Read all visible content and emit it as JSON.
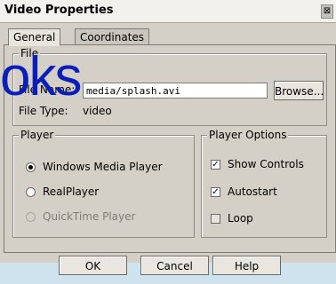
{
  "window": {
    "title": "Video Properties",
    "close_glyph": "⊠"
  },
  "tabs": [
    {
      "label": "General",
      "active": true
    },
    {
      "label": "Coordinates",
      "active": false
    }
  ],
  "file_group": {
    "legend": "File",
    "name_label": "File Name:",
    "name_value": "media/splash.avi",
    "browse_label": "Browse...",
    "type_label": "File Type:",
    "type_value": "video"
  },
  "player_group": {
    "legend": "Player",
    "options": [
      {
        "label": "Windows Media Player",
        "selected": true,
        "disabled": false
      },
      {
        "label": "RealPlayer",
        "selected": false,
        "disabled": false
      },
      {
        "label": "QuickTime Player",
        "selected": false,
        "disabled": true
      }
    ]
  },
  "player_options": {
    "legend": "Player Options",
    "items": [
      {
        "label": "Show Controls",
        "checked": true,
        "mnemonic": "S"
      },
      {
        "label": "Autostart",
        "checked": true,
        "mnemonic": "A"
      },
      {
        "label": "Loop",
        "checked": false,
        "mnemonic": "L"
      }
    ]
  },
  "buttons": {
    "ok": "OK",
    "cancel": "Cancel",
    "help": "Help"
  },
  "watermark": {
    "text": "oks"
  },
  "colors": {
    "watermark": "#0b1fb8",
    "dialog_bg": "#d4d0c8"
  }
}
